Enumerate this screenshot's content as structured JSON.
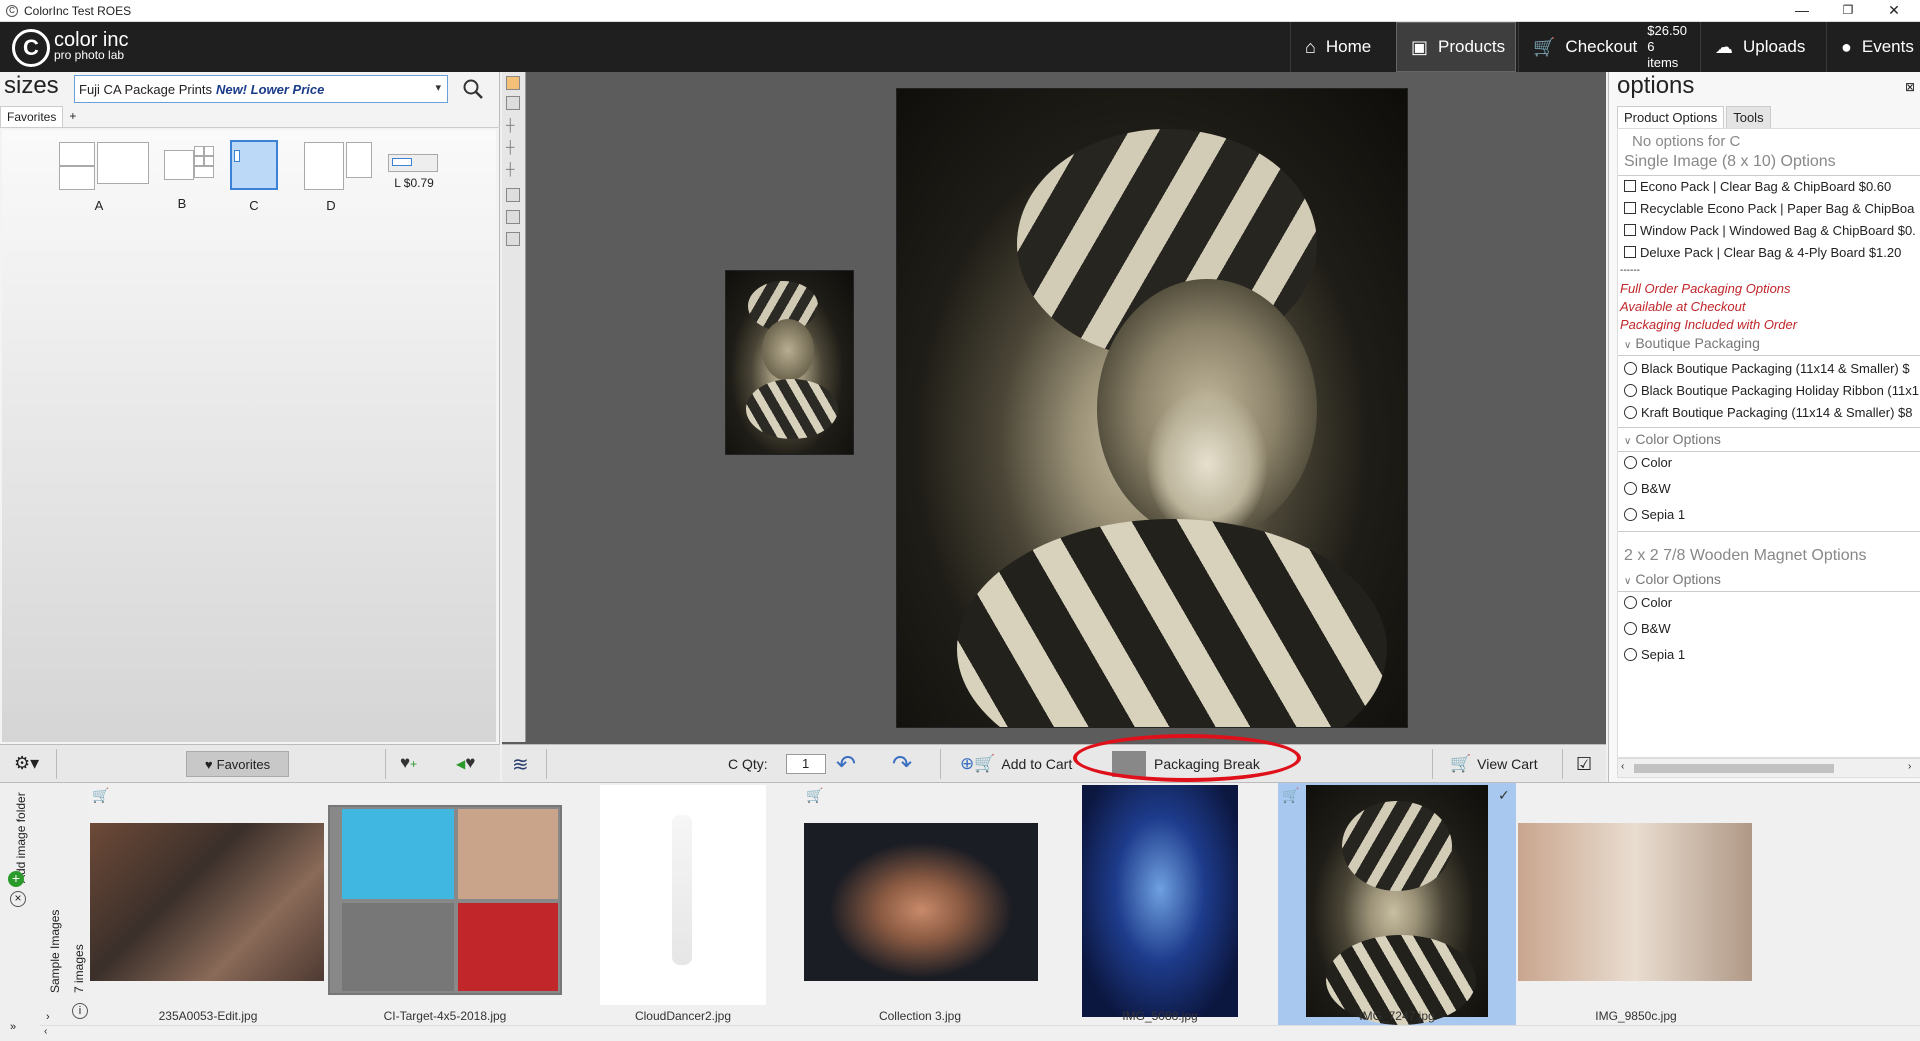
{
  "window": {
    "title": "ColorInc Test ROES",
    "minimize": "—",
    "restore": "❐",
    "close": "✕"
  },
  "nav": {
    "logo_main": "color inc",
    "logo_sub": "pro photo lab",
    "home": "Home",
    "products": "Products",
    "checkout": "Checkout",
    "checkout_price": "$26.50",
    "checkout_items": "6 items",
    "uploads": "Uploads",
    "events": "Events"
  },
  "sizes": {
    "title": "sizes",
    "product_selected": "Fuji CA Package Prints",
    "product_note": "New! Lower Price",
    "tab_favorites": "Favorites",
    "tab_add": "+",
    "tiles": [
      {
        "label": "A"
      },
      {
        "label": "B"
      },
      {
        "label": "C"
      },
      {
        "label": "D"
      },
      {
        "label": "L $0.79"
      }
    ],
    "favorites_button": "Favorites"
  },
  "center": {
    "qty_label": "C Qty:",
    "qty_value": "1",
    "add_to_cart": "Add to Cart",
    "packaging_break": "Packaging Break",
    "view_cart": "View Cart"
  },
  "options": {
    "title": "options",
    "tab_product_options": "Product Options",
    "tab_tools": "Tools",
    "no_options": "No options for C",
    "single_image_header": "Single Image (8 x 10) Options",
    "packs": [
      "Econo Pack | Clear Bag & ChipBoard $0.60",
      "Recyclable Econo Pack | Paper Bag & ChipBoa",
      "Window Pack | Windowed Bag & ChipBoard $0.",
      "Deluxe Pack | Clear Bag & 4-Ply Board $1.20"
    ],
    "dashes": "------",
    "full_order_1": "Full Order Packaging Options",
    "full_order_2": "Available at Checkout",
    "full_order_3": "Packaging Included with Order",
    "boutique_header": "Boutique Packaging",
    "boutique": [
      "Black Boutique Packaging  (11x14 & Smaller) $",
      "Black Boutique Packaging Holiday Ribbon (11x1",
      "Kraft Boutique Packaging  (11x14 & Smaller) $8"
    ],
    "color_options_header": "Color Options",
    "color_options": [
      "Color",
      "B&W",
      "Sepia 1"
    ],
    "magnet_header": "2 x 2 7/8 Wooden Magnet Options",
    "magnet_color_header": "Color Options",
    "magnet_color_options": [
      "Color",
      "B&W",
      "Sepia 1"
    ]
  },
  "filmstrip": {
    "side_label_1": "Add image folder",
    "side_label_2": "Sample Images",
    "side_count": "7 images",
    "items": [
      {
        "name": "235A0053-Edit.jpg"
      },
      {
        "name": "CI-Target-4x5-2018.jpg"
      },
      {
        "name": "CloudDancer2.jpg"
      },
      {
        "name": "Collection 3.jpg"
      },
      {
        "name": "IMG_5088.jpg"
      },
      {
        "name": "IMG_7247.jpg"
      },
      {
        "name": "IMG_9850c.jpg"
      }
    ]
  },
  "colors": {
    "navbar": "#1f1f1f",
    "accent_blue": "#3b82d6",
    "highlight_red": "#e0101a",
    "selected_thumb": "#a9c8f0"
  }
}
